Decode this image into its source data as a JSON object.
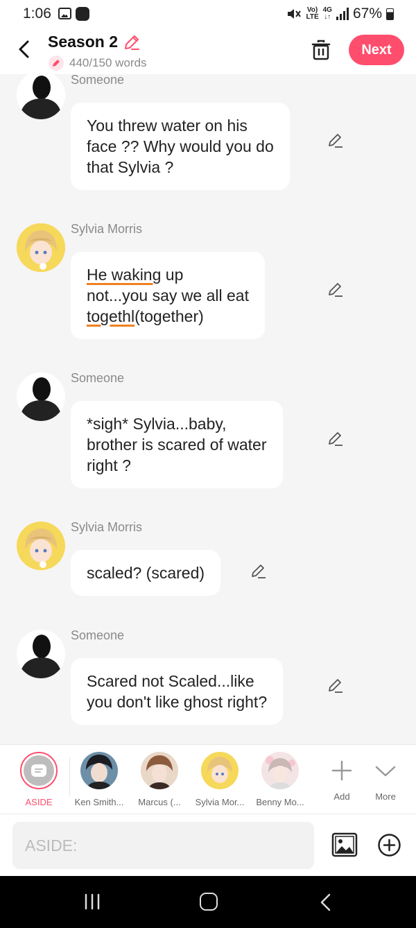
{
  "status_bar": {
    "time": "1:06",
    "net_top": "Vo)",
    "net_bottom": "LTE",
    "gen_top": "4G",
    "gen_bottom": "↓↑",
    "battery": "67%"
  },
  "header": {
    "title": "Season 2",
    "word_count": "440/150 words",
    "next_label": "Next"
  },
  "messages": [
    {
      "sender": "Someone",
      "avatar": "silhouette-avatar",
      "lines": [
        "You threw water on his",
        "face ?? Why would you do",
        "that Sylvia ?"
      ]
    },
    {
      "sender": "Sylvia Morris",
      "avatar": "anime-boy-avatar",
      "line1_underlined": "He waking",
      "line1_rest": " up",
      "line2": "not...you say we all eat",
      "line3_underlined": "togethl",
      "line3_rest": "(together)"
    },
    {
      "sender": "Someone",
      "avatar": "silhouette-avatar",
      "lines": [
        "*sigh* Sylvia...baby,",
        "brother is scared of water",
        "right ?"
      ]
    },
    {
      "sender": "Sylvia Morris",
      "avatar": "anime-boy-avatar",
      "lines": [
        "scaled? (scared)"
      ]
    },
    {
      "sender": "Someone",
      "avatar": "silhouette-avatar",
      "lines": [
        "Scared not Scaled...like",
        "you don't like ghost right?"
      ]
    }
  ],
  "characters": [
    {
      "name": "ASIDE"
    },
    {
      "name": "Ken Smith..."
    },
    {
      "name": "Marcus (..."
    },
    {
      "name": "Sylvia Mor..."
    },
    {
      "name": "Benny Mo..."
    }
  ],
  "char_actions": {
    "add": "Add",
    "more": "More"
  },
  "input": {
    "placeholder": "ASIDE:"
  },
  "colors": {
    "accent": "#ff4d6d",
    "underline": "#f08020"
  }
}
